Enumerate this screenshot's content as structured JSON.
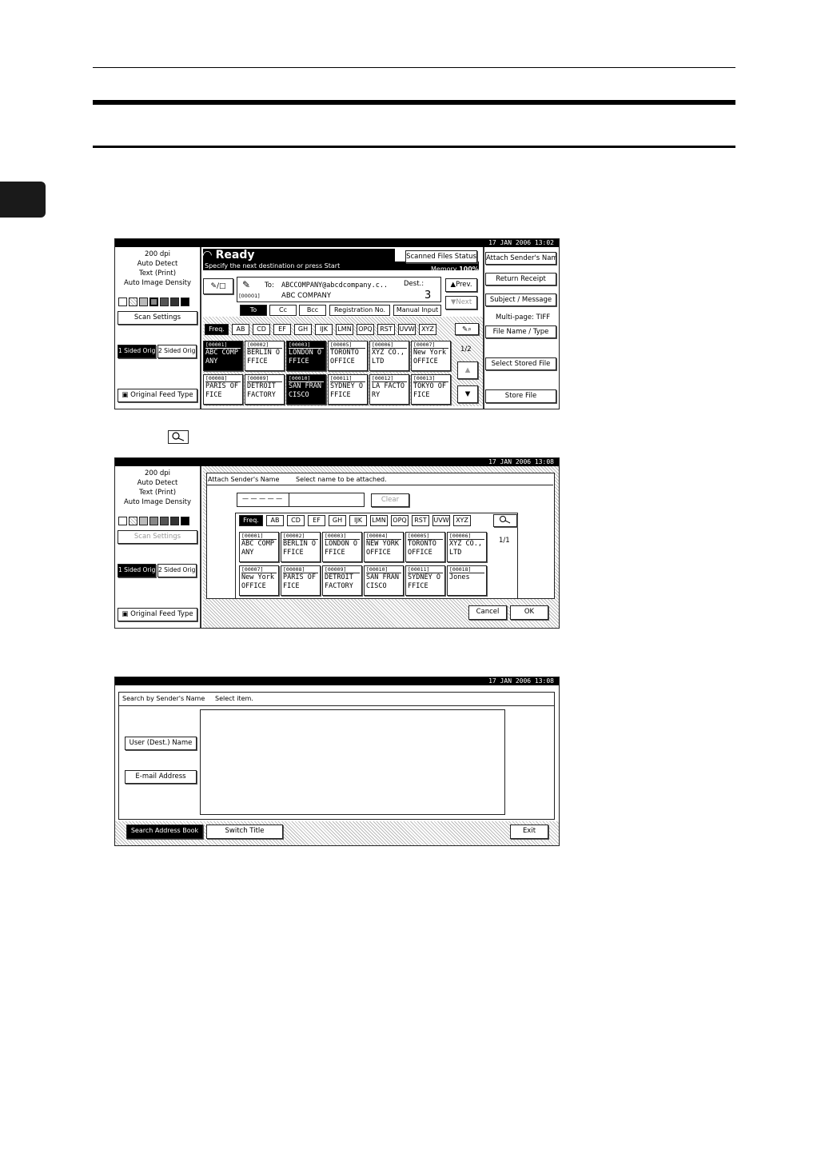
{
  "page": {
    "chapter_tab_color": "#1a1a1a",
    "inline_icon": "search-icon"
  },
  "screen1": {
    "datetime": "17 JAN  2006 13:02",
    "scan_info": [
      "200 dpi",
      "Auto Detect",
      "Text (Print)",
      "Auto Image Density"
    ],
    "scan_settings": "Scan Settings",
    "one_sided": "1 Sided Orig.",
    "two_sided": "2 Sided Orig.",
    "feed_type": "Original Feed Type",
    "ready": "Ready",
    "message": "Specify the next destination or press Start",
    "scanned_files_status": "Scanned Files Status",
    "memory_label": "Memory",
    "memory_value": "100%",
    "to_label": "To:",
    "to_address": "ABCCOMPANY@abcdcompany.c..",
    "dest_label": "Dest.:",
    "dest_count": "3",
    "entry_number": "[00001]",
    "entry_name": "ABC COMPANY",
    "prev": "▲Prev.",
    "next": "▼Next",
    "mode_tabs": [
      "To",
      "Cc",
      "Bcc"
    ],
    "registration_no": "Registration No.",
    "manual_input": "Manual Input",
    "index_tabs": [
      "Freq.",
      "AB",
      "CD",
      "EF",
      "GH",
      "IJK",
      "LMN",
      "OPQ",
      "RST",
      "UVW",
      "XYZ"
    ],
    "page_indicator": "1/2",
    "destinations": [
      {
        "num": "[00001]",
        "line1": "ABC COMP",
        "line2": "ANY",
        "selected": true
      },
      {
        "num": "[00002]",
        "line1": "BERLIN O",
        "line2": "FFICE",
        "selected": false
      },
      {
        "num": "[00003]",
        "line1": "LONDON O",
        "line2": "FFICE",
        "selected": true
      },
      {
        "num": "[00005]",
        "line1": "TORONTO",
        "line2": "OFFICE",
        "selected": false
      },
      {
        "num": "[00006]",
        "line1": "XYZ CO.,",
        "line2": "LTD",
        "selected": false
      },
      {
        "num": "[00007]",
        "line1": "New York",
        "line2": "OFFICE",
        "selected": false
      },
      {
        "num": "[00008]",
        "line1": "PARIS OF",
        "line2": "FICE",
        "selected": false
      },
      {
        "num": "[00009]",
        "line1": "DETROIT",
        "line2": "FACTORY",
        "selected": false
      },
      {
        "num": "[00010]",
        "line1": "SAN FRAN",
        "line2": "CISCO",
        "selected": true
      },
      {
        "num": "[00011]",
        "line1": "SYDNEY O",
        "line2": "FFICE",
        "selected": false
      },
      {
        "num": "[00012]",
        "line1": "LA FACTO",
        "line2": "RY",
        "selected": false
      },
      {
        "num": "[00013]",
        "line1": "TOKYO OF",
        "line2": "FICE",
        "selected": false
      }
    ],
    "right_buttons": [
      "Attach Sender's Name",
      "Return Receipt",
      "Subject / Message"
    ],
    "multipage": "Multi-page: TIFF",
    "file_name_type": "File Name / Type",
    "select_stored_file": "Select Stored File",
    "store_file": "Store File"
  },
  "screen2": {
    "datetime": "17 JAN  2006 13:08",
    "scan_info": [
      "200 dpi",
      "Auto Detect",
      "Text (Print)",
      "Auto Image Density"
    ],
    "scan_settings": "Scan Settings",
    "one_sided": "1 Sided Orig.",
    "two_sided": "2 Sided Orig.",
    "feed_type": "Original Feed Type",
    "title": "Attach Sender's Name",
    "instruction": "Select name to be attached.",
    "input_value": "— — — — —",
    "clear": "Clear",
    "index_tabs": [
      "Freq.",
      "AB",
      "CD",
      "EF",
      "GH",
      "IJK",
      "LMN",
      "OPQ",
      "RST",
      "UVW",
      "XYZ"
    ],
    "page_indicator": "1/1",
    "senders": [
      {
        "num": "[00001]",
        "line1": "ABC COMP",
        "line2": "ANY"
      },
      {
        "num": "[00002]",
        "line1": "BERLIN O",
        "line2": "FFICE"
      },
      {
        "num": "[00003]",
        "line1": "LONDON O",
        "line2": "FFICE"
      },
      {
        "num": "[00004]",
        "line1": "NEW YORK",
        "line2": "OFFICE"
      },
      {
        "num": "[00005]",
        "line1": "TORONTO",
        "line2": "OFFICE"
      },
      {
        "num": "[00006]",
        "line1": "XYZ CO.,",
        "line2": "LTD"
      },
      {
        "num": "[00007]",
        "line1": "New York",
        "line2": "OFFICE"
      },
      {
        "num": "[00008]",
        "line1": "PARIS OF",
        "line2": "FICE"
      },
      {
        "num": "[00009]",
        "line1": "DETROIT",
        "line2": "FACTORY"
      },
      {
        "num": "[00010]",
        "line1": "SAN FRAN",
        "line2": "CISCO"
      },
      {
        "num": "[00011]",
        "line1": "SYDNEY O",
        "line2": "FFICE"
      },
      {
        "num": "[00018]",
        "line1": "Jones",
        "line2": ""
      }
    ],
    "cancel": "Cancel",
    "ok": "OK"
  },
  "screen3": {
    "datetime": "17 JAN  2006 13:08",
    "title": "Search by Sender's Name",
    "instruction": "Select item.",
    "user_name": "User (Dest.) Name",
    "email": "E-mail Address",
    "search_address_book": "Search Address Book",
    "switch_title": "Switch Title",
    "exit": "Exit"
  }
}
